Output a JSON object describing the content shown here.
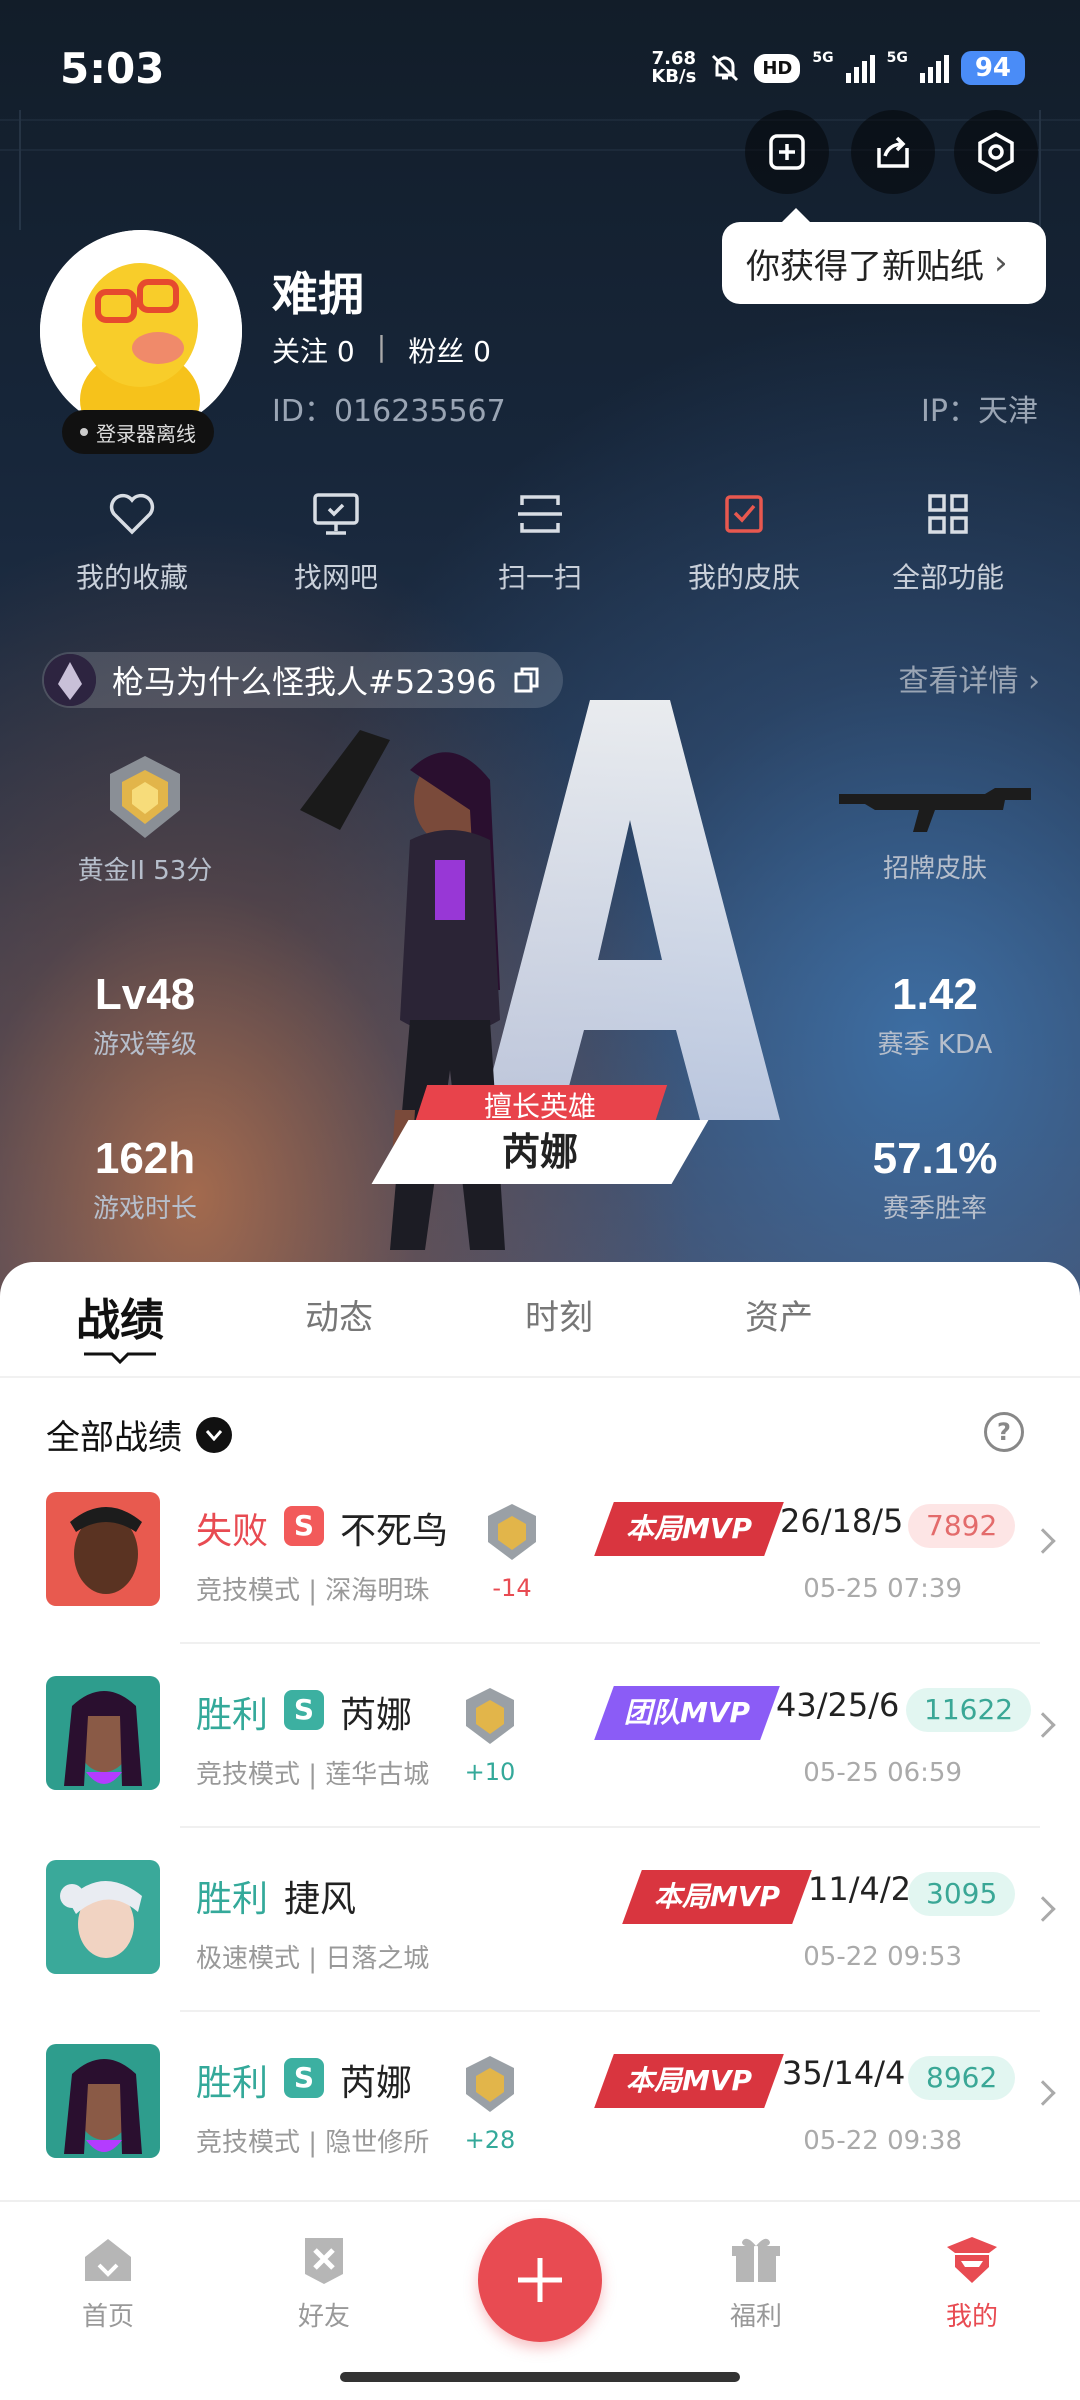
{
  "status": {
    "time": "5:03",
    "net_speed_top": "7.68",
    "net_speed_bottom": "KB/s",
    "hd": "HD",
    "g5": "5G",
    "battery": "94"
  },
  "toast": {
    "text": "你获得了新贴纸"
  },
  "profile": {
    "name": "难拥",
    "follow_label": "关注",
    "follow_count": "0",
    "fans_label": "粉丝",
    "fans_count": "0",
    "separator": "|",
    "id": "ID：016235567",
    "ip": "IP：天津",
    "login_status": "登录器离线"
  },
  "quick_actions": [
    {
      "label": "我的收藏",
      "icon": "heart-icon"
    },
    {
      "label": "找网吧",
      "icon": "monitor-icon"
    },
    {
      "label": "扫一扫",
      "icon": "scan-icon"
    },
    {
      "label": "我的皮肤",
      "icon": "skin-icon"
    },
    {
      "label": "全部功能",
      "icon": "grid-icon"
    }
  ],
  "account": {
    "name": "枪马为什么怪我人#52396",
    "detail_link": "查看详情"
  },
  "stats": {
    "rank": "黄金II 53分",
    "signature_skin": "招牌皮肤",
    "level_value": "Lv48",
    "level_label": "游戏等级",
    "kda_value": "1.42",
    "kda_label": "赛季 KDA",
    "time_value": "162h",
    "time_label": "游戏时长",
    "winrate_value": "57.1%",
    "winrate_label": "赛季胜率",
    "best_hero_tag": "擅长英雄",
    "best_hero": "芮娜"
  },
  "tabs": [
    {
      "label": "战绩",
      "active": true
    },
    {
      "label": "动态",
      "active": false
    },
    {
      "label": "时刻",
      "active": false
    },
    {
      "label": "资产",
      "active": false
    }
  ],
  "filter": {
    "label": "全部战绩"
  },
  "matches": [
    {
      "result": "失败",
      "result_type": "lose",
      "s_badge": "S",
      "s_color": "#f25a5a",
      "hero": "不死鸟",
      "mode": "竞技模式 | 深海明珠",
      "delta": "-14",
      "mvp": "本局MVP",
      "mvp_color": "#d9353f",
      "kda": "26/18/5",
      "score": "7892",
      "score_type": "red",
      "date": "05-25 07:39",
      "has_rank": true
    },
    {
      "result": "胜利",
      "result_type": "win",
      "s_badge": "S",
      "s_color": "#3cb0a1",
      "hero": "芮娜",
      "mode": "竞技模式 | 莲华古城",
      "delta": "+10",
      "mvp": "团队MVP",
      "mvp_color": "#8b5cf6",
      "kda": "43/25/6",
      "score": "11622",
      "score_type": "green",
      "date": "05-25 06:59",
      "has_rank": true
    },
    {
      "result": "胜利",
      "result_type": "win",
      "s_badge": "",
      "s_color": "",
      "hero": "捷风",
      "mode": "极速模式 | 日落之城",
      "delta": "",
      "mvp": "本局MVP",
      "mvp_color": "#d9353f",
      "kda": "11/4/2",
      "score": "3095",
      "score_type": "green",
      "date": "05-22 09:53",
      "has_rank": false
    },
    {
      "result": "胜利",
      "result_type": "win",
      "s_badge": "S",
      "s_color": "#3cb0a1",
      "hero": "芮娜",
      "mode": "竞技模式 | 隐世修所",
      "delta": "+28",
      "mvp": "本局MVP",
      "mvp_color": "#d9353f",
      "kda": "35/14/4",
      "score": "8962",
      "score_type": "green",
      "date": "05-22 09:38",
      "has_rank": true
    }
  ],
  "bottom_nav": [
    {
      "label": "首页",
      "icon": "home-icon",
      "active": false
    },
    {
      "label": "好友",
      "icon": "friends-icon",
      "active": false
    },
    {
      "label": "福利",
      "icon": "gift-icon",
      "active": false
    },
    {
      "label": "我的",
      "icon": "profile-icon",
      "active": true
    }
  ]
}
